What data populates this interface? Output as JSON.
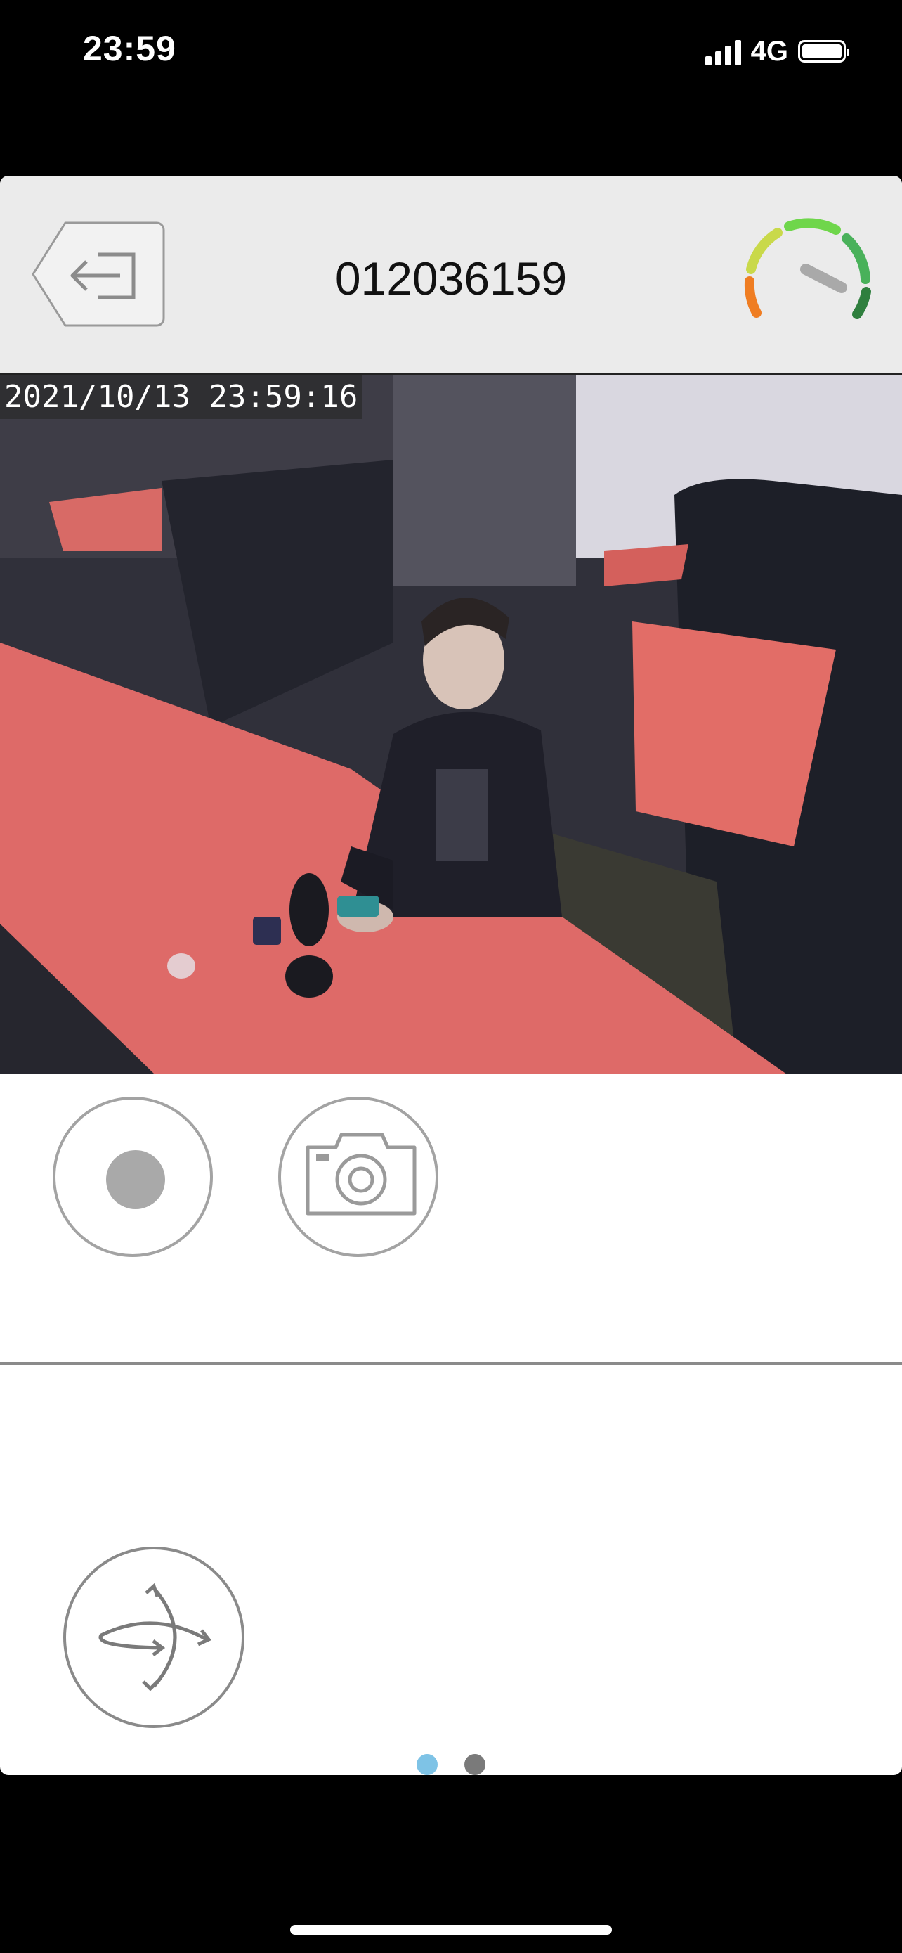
{
  "status_bar": {
    "time": "23:59",
    "network": "4G",
    "signal_icon": "cellular-signal-icon",
    "battery_icon": "battery-full-icon"
  },
  "header": {
    "device_id": "012036159",
    "back_icon": "back-exit-icon",
    "quality_icon": "speed-gauge-icon"
  },
  "video": {
    "timestamp": "2021/10/13 23:59:16"
  },
  "controls": {
    "record_icon": "record-icon",
    "snapshot_icon": "camera-icon"
  },
  "ptz": {
    "icon": "ptz-rotate-arrows-icon"
  },
  "pager": {
    "page_count": 2,
    "active_page": 1,
    "active_color": "#7ec3e6",
    "inactive_color": "#7a7a7a"
  }
}
